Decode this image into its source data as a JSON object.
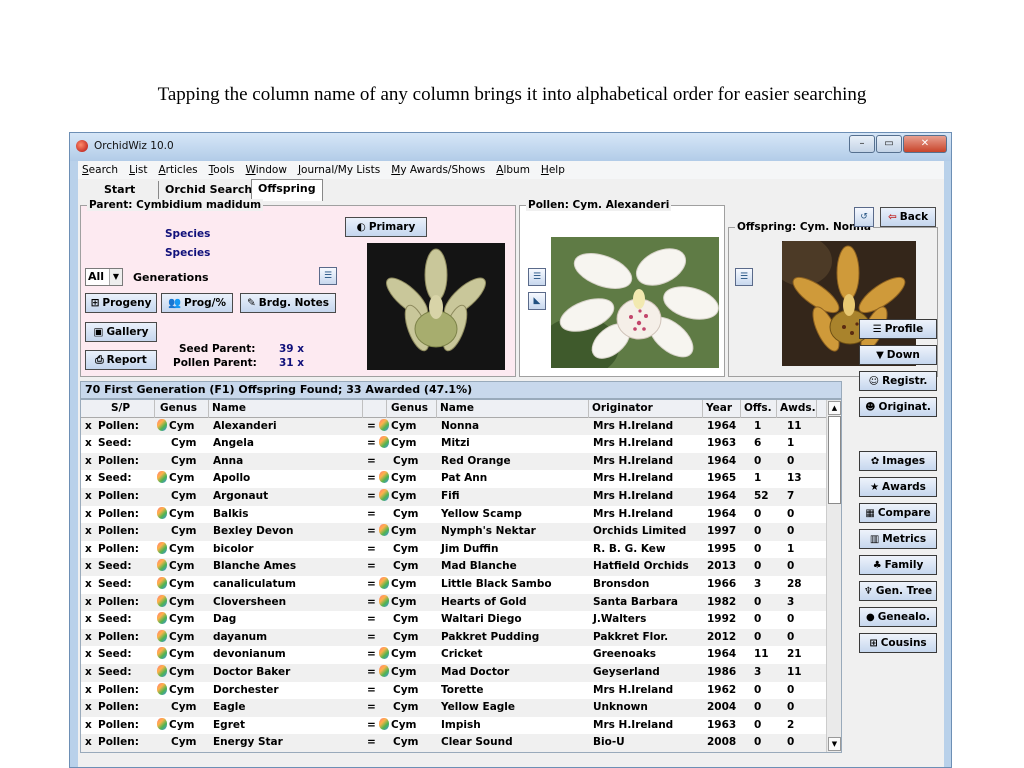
{
  "caption": "Tapping the column name of any column brings it into alphabetical order for easier searching",
  "window": {
    "title": "OrchidWiz 10.0",
    "controls": {
      "minimize": "–",
      "maximize": "▭",
      "close": "✕"
    }
  },
  "menu": [
    "Search",
    "List",
    "Articles",
    "Tools",
    "Window",
    "Journal/My Lists",
    "My Awards/Shows",
    "Album",
    "Help"
  ],
  "tabs": [
    "Start",
    "Orchid Search",
    "Offspring"
  ],
  "parent": {
    "legend": "Parent: Cymbidium madidum",
    "species1": "Species",
    "species2": "Species",
    "primary_label": "Primary",
    "generations_value": "All",
    "generations_label": "Generations",
    "progeny_label": "Progeny",
    "prog_pct_label": "Prog/%",
    "brdg_notes_label": "Brdg. Notes",
    "gallery_label": "Gallery",
    "report_label": "Report",
    "seed_parent_label": "Seed Parent:",
    "seed_parent_value": "39 x",
    "pollen_parent_label": "Pollen Parent:",
    "pollen_parent_value": "31 x"
  },
  "pollen": {
    "legend": "Pollen: Cym. Alexanderi"
  },
  "offspring": {
    "legend": "Offspring: Cym. Nonna",
    "back_label": "Back"
  },
  "grid": {
    "summary": "70 First Generation (F1) Offspring Found; 33 Awarded (47.1%)",
    "headers": [
      "S/P",
      "Genus",
      "Name",
      "Genus",
      "Name",
      "Originator",
      "Year",
      "Offs.",
      "Awds."
    ],
    "rows": [
      [
        "x",
        "Pollen:",
        true,
        "Cym",
        "Alexanderi",
        "=",
        true,
        "Cym",
        "Nonna",
        "Mrs H.Ireland",
        "1964",
        "1",
        "11"
      ],
      [
        "x",
        "Seed:",
        false,
        "Cym",
        "Angela",
        "=",
        true,
        "Cym",
        "Mitzi",
        "Mrs H.Ireland",
        "1963",
        "6",
        "1"
      ],
      [
        "x",
        "Pollen:",
        false,
        "Cym",
        "Anna",
        "=",
        false,
        "Cym",
        "Red Orange",
        "Mrs H.Ireland",
        "1964",
        "0",
        "0"
      ],
      [
        "x",
        "Seed:",
        true,
        "Cym",
        "Apollo",
        "=",
        true,
        "Cym",
        "Pat Ann",
        "Mrs H.Ireland",
        "1965",
        "1",
        "13"
      ],
      [
        "x",
        "Pollen:",
        false,
        "Cym",
        "Argonaut",
        "=",
        true,
        "Cym",
        "Fifi",
        "Mrs H.Ireland",
        "1964",
        "52",
        "7"
      ],
      [
        "x",
        "Pollen:",
        true,
        "Cym",
        "Balkis",
        "=",
        false,
        "Cym",
        "Yellow Scamp",
        "Mrs H.Ireland",
        "1964",
        "0",
        "0"
      ],
      [
        "x",
        "Pollen:",
        false,
        "Cym",
        "Bexley Devon",
        "=",
        true,
        "Cym",
        "Nymph's Nektar",
        "Orchids Limited",
        "1997",
        "0",
        "0"
      ],
      [
        "x",
        "Pollen:",
        true,
        "Cym",
        "bicolor",
        "=",
        false,
        "Cym",
        "Jim Duffin",
        "R. B. G. Kew",
        "1995",
        "0",
        "1"
      ],
      [
        "x",
        "Seed:",
        true,
        "Cym",
        "Blanche Ames",
        "=",
        false,
        "Cym",
        "Mad Blanche",
        "Hatfield Orchids",
        "2013",
        "0",
        "0"
      ],
      [
        "x",
        "Seed:",
        true,
        "Cym",
        "canaliculatum",
        "=",
        true,
        "Cym",
        "Little Black Sambo",
        "Bronsdon",
        "1966",
        "3",
        "28"
      ],
      [
        "x",
        "Pollen:",
        true,
        "Cym",
        "Cloversheen",
        "=",
        true,
        "Cym",
        "Hearts of Gold",
        "Santa Barbara",
        "1982",
        "0",
        "3"
      ],
      [
        "x",
        "Seed:",
        true,
        "Cym",
        "Dag",
        "=",
        false,
        "Cym",
        "Waltari Diego",
        "J.Walters",
        "1992",
        "0",
        "0"
      ],
      [
        "x",
        "Pollen:",
        true,
        "Cym",
        "dayanum",
        "=",
        false,
        "Cym",
        "Pakkret Pudding",
        "Pakkret Flor.",
        "2012",
        "0",
        "0"
      ],
      [
        "x",
        "Seed:",
        true,
        "Cym",
        "devonianum",
        "=",
        true,
        "Cym",
        "Cricket",
        "Greenoaks",
        "1964",
        "11",
        "21"
      ],
      [
        "x",
        "Seed:",
        true,
        "Cym",
        "Doctor Baker",
        "=",
        true,
        "Cym",
        "Mad Doctor",
        "Geyserland",
        "1986",
        "3",
        "11"
      ],
      [
        "x",
        "Pollen:",
        true,
        "Cym",
        "Dorchester",
        "=",
        false,
        "Cym",
        "Torette",
        "Mrs H.Ireland",
        "1962",
        "0",
        "0"
      ],
      [
        "x",
        "Pollen:",
        false,
        "Cym",
        "Eagle",
        "=",
        false,
        "Cym",
        "Yellow Eagle",
        "Unknown",
        "2004",
        "0",
        "0"
      ],
      [
        "x",
        "Pollen:",
        true,
        "Cym",
        "Egret",
        "=",
        true,
        "Cym",
        "Impish",
        "Mrs H.Ireland",
        "1963",
        "0",
        "2"
      ],
      [
        "x",
        "Pollen:",
        false,
        "Cym",
        "Energy Star",
        "=",
        false,
        "Cym",
        "Clear Sound",
        "Bio-U",
        "2008",
        "0",
        "0"
      ]
    ]
  },
  "side_buttons": [
    {
      "label": "Profile",
      "icon": "profile-icon"
    },
    {
      "label": "Down",
      "icon": "down-icon"
    },
    {
      "label": "Registr.",
      "icon": "registration-icon"
    },
    {
      "label": "Originat.",
      "icon": "originator-icon"
    },
    {
      "label": "Images",
      "icon": "images-icon"
    },
    {
      "label": "Awards",
      "icon": "awards-icon"
    },
    {
      "label": "Compare",
      "icon": "compare-icon"
    },
    {
      "label": "Metrics",
      "icon": "metrics-icon"
    },
    {
      "label": "Family",
      "icon": "family-icon"
    },
    {
      "label": "Gen. Tree",
      "icon": "gen-tree-icon"
    },
    {
      "label": "Genealo.",
      "icon": "genealogy-icon"
    },
    {
      "label": "Cousins",
      "icon": "cousins-icon"
    }
  ],
  "colors": {
    "parent_panel_bg": "#fdeaf1",
    "link_blue": "#10107a",
    "window_frame": "#b9d1ea"
  }
}
